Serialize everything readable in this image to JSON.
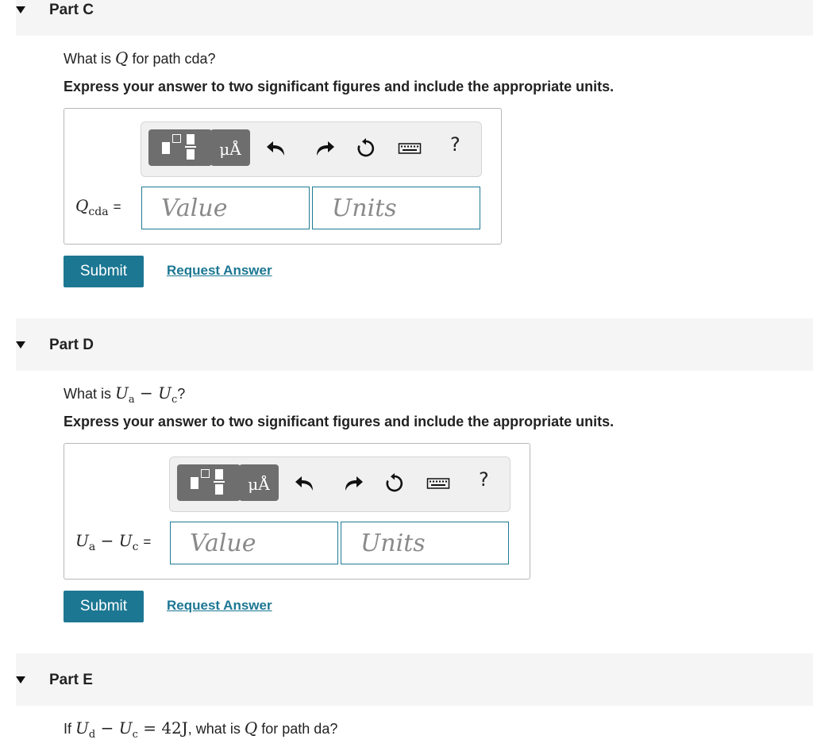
{
  "parts": [
    {
      "title": "Part C",
      "question_prefix": "What is",
      "question_symbol": "Q",
      "question_suffix": "for path cda?",
      "instruction": "Express your answer to two significant figures and include the appropriate units.",
      "variable": {
        "symbol": "Q",
        "subscript": "cda",
        "equals": "="
      },
      "unit_button_label": "μÅ",
      "help_label": "?",
      "value_placeholder": "Value",
      "units_placeholder": "Units",
      "submit_label": "Submit",
      "request_label": "Request Answer"
    },
    {
      "title": "Part D",
      "question_prefix": "What is",
      "question_math": {
        "a": "U",
        "a_sub": "a",
        "minus": "−",
        "b": "U",
        "b_sub": "c"
      },
      "question_suffix": "?",
      "instruction": "Express your answer to two significant figures and include the appropriate units.",
      "variable": {
        "a": "U",
        "a_sub": "a",
        "minus": "−",
        "b": "U",
        "b_sub": "c",
        "equals": "="
      },
      "unit_button_label": "μÅ",
      "help_label": "?",
      "value_placeholder": "Value",
      "units_placeholder": "Units",
      "submit_label": "Submit",
      "request_label": "Request Answer"
    },
    {
      "title": "Part E",
      "question_prefix": "If",
      "question_math": {
        "a": "U",
        "a_sub": "d",
        "minus": "−",
        "b": "U",
        "b_sub": "c",
        "eq": "=",
        "value": "42J"
      },
      "question_mid": ", what is",
      "question_symbol": "Q",
      "question_suffix": "for path da?"
    }
  ],
  "icons": {
    "toggle": "triangle-down-icon",
    "template": "fraction-template-icon",
    "undo": "undo-icon",
    "redo": "redo-icon",
    "reset": "reset-icon",
    "keyboard": "keyboard-icon",
    "help": "help-icon"
  },
  "colors": {
    "accent": "#1c7793",
    "header_bg": "#f5f5f5",
    "toolbar_btn": "#6e6e6e"
  }
}
